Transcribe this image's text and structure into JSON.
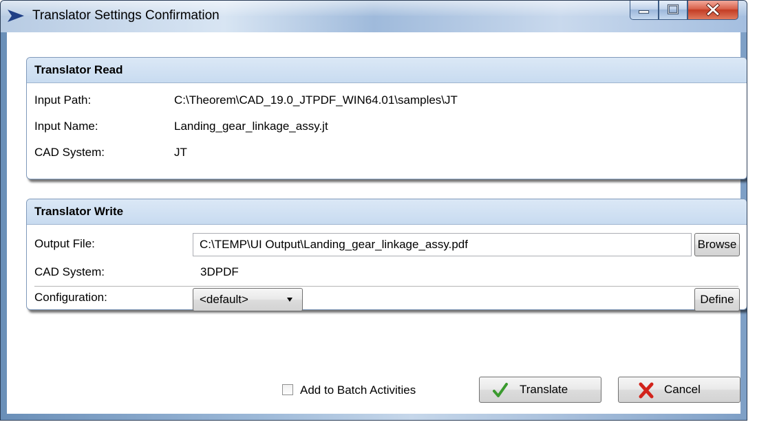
{
  "window": {
    "title": "Translator Settings Confirmation",
    "app_icon": "arrow-chevron-icon",
    "controls": {
      "minimize": "minimize-icon",
      "maximize": "maximize-icon",
      "close": "close-icon"
    }
  },
  "read_group": {
    "header": "Translator Read",
    "rows": [
      {
        "label": "Input Path:",
        "value": "C:\\Theorem\\CAD_19.0_JTPDF_WIN64.01\\samples\\JT"
      },
      {
        "label": "Input Name:",
        "value": "Landing_gear_linkage_assy.jt"
      },
      {
        "label": "CAD System:",
        "value": "JT"
      }
    ]
  },
  "write_group": {
    "header": "Translator Write",
    "output_file_label": "Output File:",
    "output_file_value": "C:\\TEMP\\UI Output\\Landing_gear_linkage_assy.pdf",
    "browse_label": "Browse",
    "cad_system_label": "CAD System:",
    "cad_system_value": "3DPDF",
    "configuration_label": "Configuration:",
    "configuration_value": "<default>",
    "define_label": "Define"
  },
  "footer": {
    "batch_checkbox_label": "Add to Batch Activities",
    "batch_checked": false,
    "translate_label": "Translate",
    "translate_icon": "checkmark-icon",
    "cancel_label": "Cancel",
    "cancel_icon": "red-x-icon"
  },
  "colors": {
    "header_bg": "#c8dbf0",
    "close_button": "#c33c24",
    "checkmark": "#3a9a2e",
    "cancel_x": "#d2231b",
    "app_icon": "#1f3f86"
  }
}
